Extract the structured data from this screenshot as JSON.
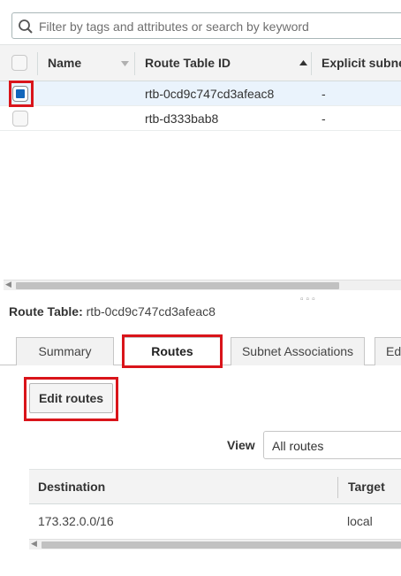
{
  "search": {
    "placeholder": "Filter by tags and attributes or search by keyword"
  },
  "table": {
    "columns": [
      "Name",
      "Route Table ID",
      "Explicit subne"
    ],
    "rows": [
      {
        "name": "",
        "route_table_id": "rtb-0cd9c747cd3afeac8",
        "explicit_subnet": "-",
        "selected": true
      },
      {
        "name": "",
        "route_table_id": "rtb-d333bab8",
        "explicit_subnet": "-",
        "selected": false
      }
    ]
  },
  "details": {
    "label": "Route Table:",
    "value": "rtb-0cd9c747cd3afeac8",
    "tabs": [
      "Summary",
      "Routes",
      "Subnet Associations",
      "Ed"
    ],
    "active_tab": "Routes",
    "edit_button": "Edit routes",
    "view_label": "View",
    "view_selected": "All routes",
    "routes_columns": [
      "Destination",
      "Target"
    ],
    "routes": [
      {
        "destination": "173.32.0.0/16",
        "target": "local"
      }
    ]
  },
  "colors": {
    "highlight": "#d9141a",
    "checkbox_checked": "#1166bb",
    "selected_row": "#eaf3fc",
    "header_bg": "#f3f3f3"
  }
}
